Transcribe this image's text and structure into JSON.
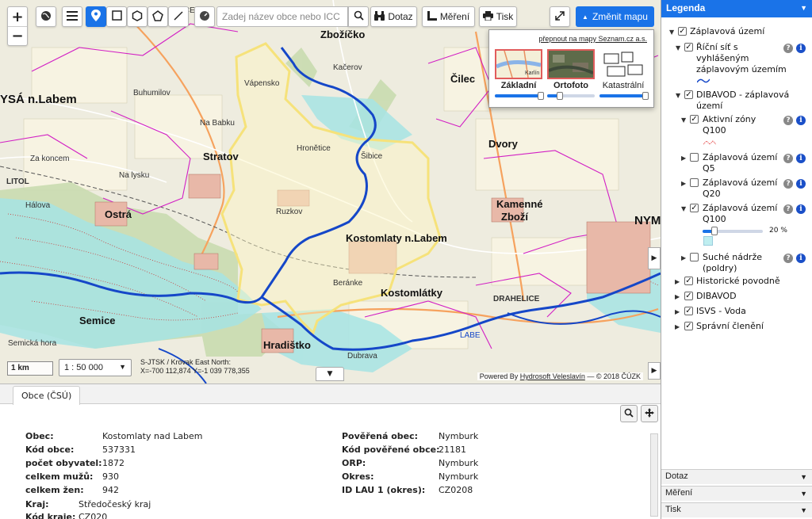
{
  "toolbar": {
    "zoom_in": "+",
    "zoom_out": "−",
    "search_placeholder": "Zadej název obce nebo ICC",
    "dotaz": "Dotaz",
    "mereni": "Měření",
    "tisk": "Tisk",
    "change_map": "Změnit mapu",
    "colors": {
      "accent": "#1a73e8"
    }
  },
  "basemaps": {
    "seznam_link": "přepnout na mapy Seznam.cz a.s.",
    "items": [
      {
        "name": "Základní",
        "thumb_label": "Karlín",
        "opacity": 1.0,
        "selected": true
      },
      {
        "name": "Ortofoto",
        "opacity": 0.2,
        "selected": false
      },
      {
        "name": "Katastrální",
        "opacity": 1.0,
        "selected": false
      }
    ]
  },
  "map": {
    "scale_bar": "1 km",
    "scale_value": "1 : 50 000",
    "coords_line1": "S-JTSK / Krovak East North:",
    "coords_line2": "X=-700 112,874 Y=-1 039 778,355",
    "attribution_pre": "Powered By ",
    "attribution_link": "Hydrosoft Veleslavín",
    "attribution_post": " — © 2018 ČÚZK",
    "labels": {
      "milovice": "MILOVICE",
      "lysa": "YSÁ n.Labem",
      "zbozicko": "Zbožíčko",
      "kacerov": "Kačerov",
      "cilec": "Čilec",
      "vapensko": "Vápensko",
      "stratov": "Stratov",
      "hronetice": "Hronětice",
      "sibice": "Šibice",
      "dvory": "Dvory",
      "ostra": "Ostrá",
      "kamenne": "Kamenné",
      "zbozi": "Zboží",
      "kostomlaty": "Kostomlaty n.Labem",
      "semice": "Semice",
      "hradistko": "Hradištko",
      "kostomlatky": "Kostomlátky",
      "drahelice": "DRAHELICE",
      "nym": "NYM",
      "labe": "LABE",
      "buhumilov": "Buhumilov",
      "na_babku": "Na Babku",
      "za_koncem": "Za koncem",
      "na_lysku": "Na lysku",
      "halova": "Hálova",
      "beranke": "Beránke",
      "ruzkov": "Ruzkov",
      "dubrava": "Dubrava",
      "litol": "LITOL",
      "semicka_hora": "Semická hora"
    }
  },
  "info": {
    "tab": "Obce (ČSÚ)",
    "left": [
      {
        "label": "Obec:",
        "value": "Kostomlaty nad Labem"
      },
      {
        "label": "Kód obce:",
        "value": "537331"
      },
      {
        "label": "počet obyvatel:",
        "value": "1872"
      },
      {
        "label": "celkem mužů:",
        "value": "930"
      },
      {
        "label": "celkem žen:",
        "value": "942"
      },
      {
        "label": "Kraj:",
        "value": "Středočeský kraj"
      },
      {
        "label": "Kód kraje:",
        "value": "CZ020"
      }
    ],
    "right": [
      {
        "label": "Pověřená obec:",
        "value": "Nymburk"
      },
      {
        "label": "Kód pověřené obce:",
        "value": "21181"
      },
      {
        "label": "ORP:",
        "value": "Nymburk"
      },
      {
        "label": "Okres:",
        "value": "Nymburk"
      },
      {
        "label": "ID LAU 1 (okres):",
        "value": "CZ0208"
      }
    ]
  },
  "legend": {
    "title": "Legenda",
    "items": {
      "zaplavova": "Záplavová území",
      "ricni_1": "Říční síť s",
      "ricni_2": "vyhlášeným",
      "ricni_3": "záplavovým územím",
      "dibavod_z_1": "DIBAVOD - záplavová",
      "dibavod_z_2": "území",
      "aktivni_1": "Aktivní zóny",
      "aktivni_2": "Q100",
      "q5_1": "Záplavová území",
      "q5_2": "Q5",
      "q20_1": "Záplavová území",
      "q20_2": "Q20",
      "q100_1": "Záplavová území",
      "q100_2": "Q100",
      "q100_opacity": "20 %",
      "suche_1": "Suché nádrže",
      "suche_2": "(poldry)",
      "historicke": "Historické povodně",
      "dibavod": "DIBAVOD",
      "isvs": "ISVS - Voda",
      "spravni": "Správní členění"
    },
    "q100_opacity_value": 0.2,
    "accordions": [
      "Dotaz",
      "Měření",
      "Tisk"
    ]
  }
}
